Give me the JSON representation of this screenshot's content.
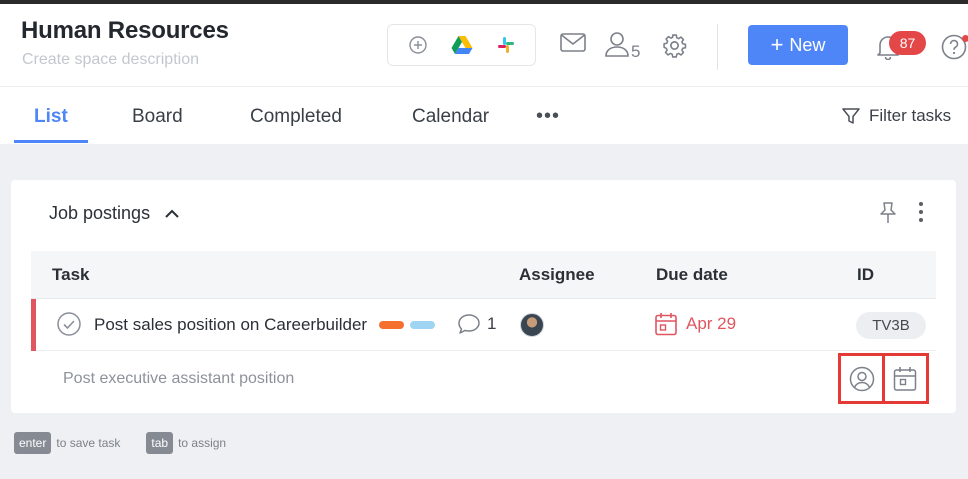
{
  "header": {
    "title": "Human Resources",
    "description_placeholder": "Create space description",
    "member_count": "5",
    "new_button_label": "New",
    "notification_count": "87",
    "integrations": [
      "add-integration-icon",
      "google-drive-icon",
      "slack-icon"
    ]
  },
  "tabs": [
    {
      "label": "List",
      "active": true
    },
    {
      "label": "Board",
      "active": false
    },
    {
      "label": "Completed",
      "active": false
    },
    {
      "label": "Calendar",
      "active": false
    }
  ],
  "more_tabs": "•••",
  "filter_label": "Filter tasks",
  "section": {
    "title": "Job postings",
    "columns": {
      "task": "Task",
      "assignee": "Assignee",
      "due": "Due date",
      "id": "ID"
    },
    "tasks": [
      {
        "name": "Post sales position on Careerbuilder",
        "tag_colors": [
          "#f5702e",
          "#9fd4f2"
        ],
        "comments": "1",
        "due": "Apr 29",
        "id": "TV3B"
      }
    ],
    "new_task_value": "Post executive assistant position"
  },
  "hints": [
    {
      "key": "enter",
      "text": "to save task"
    },
    {
      "key": "tab",
      "text": "to assign"
    }
  ],
  "colors": {
    "accent": "#4f86f7",
    "overdue": "#e05560",
    "highlight": "#e53935"
  }
}
